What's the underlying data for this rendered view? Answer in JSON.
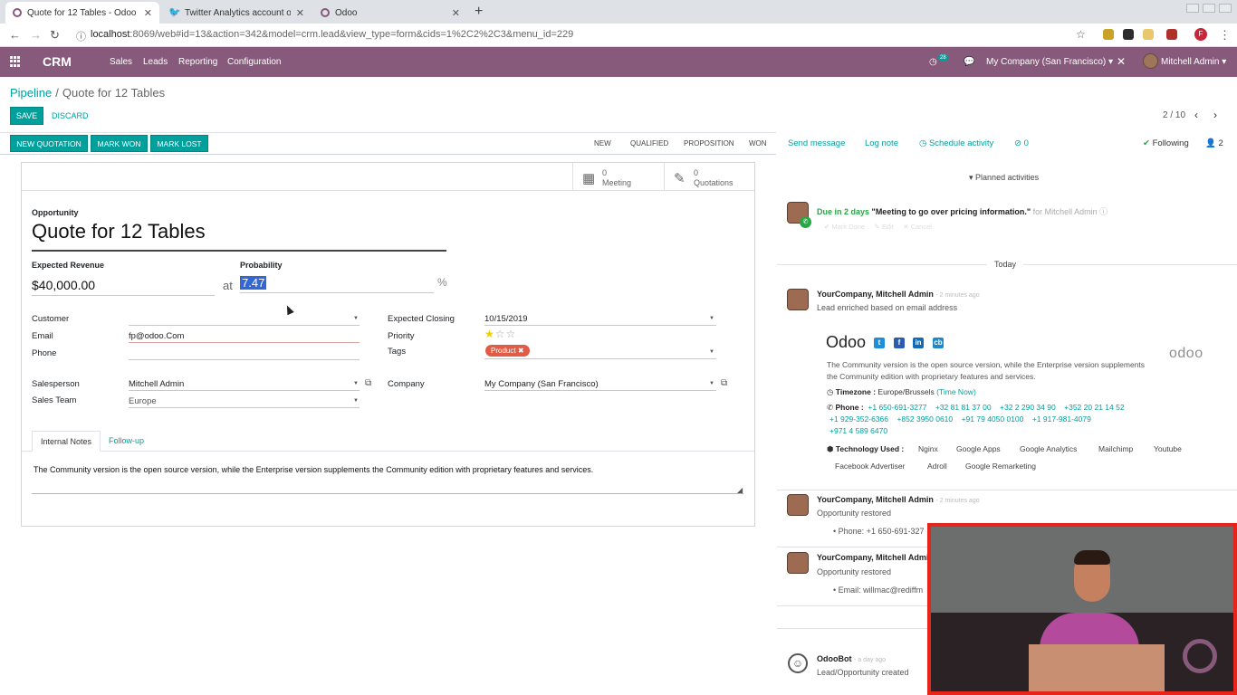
{
  "browser": {
    "tabs": [
      {
        "title": "Quote for 12 Tables - Odoo",
        "active": true
      },
      {
        "title": "Twitter Analytics account ov",
        "active": false
      },
      {
        "title": "Odoo",
        "active": false
      }
    ],
    "url_host": "localhost",
    "url_rest": ":8069/web#id=13&action=342&model=crm.lead&view_type=form&cids=1%2C2%2C3&menu_id=229",
    "profile_initial": "F"
  },
  "navbar": {
    "brand": "CRM",
    "menus": [
      "Sales",
      "Leads",
      "Reporting",
      "Configuration"
    ],
    "activity_count": "28",
    "company": "My Company (San Francisco)",
    "user": "Mitchell Admin"
  },
  "breadcrumb": {
    "parent": "Pipeline",
    "separator": "/",
    "current": "Quote for 12 Tables"
  },
  "actions": {
    "save": "SAVE",
    "discard": "DISCARD"
  },
  "pager": {
    "text": "2 / 10"
  },
  "statusbar": {
    "buttons": [
      "NEW QUOTATION",
      "MARK WON",
      "MARK LOST"
    ],
    "stages": [
      "NEW",
      "QUALIFIED",
      "PROPOSITION",
      "WON"
    ]
  },
  "smart_buttons": [
    {
      "count": "0",
      "label": "Meeting",
      "icon": "calendar-icon"
    },
    {
      "count": "0",
      "label": "Quotations",
      "icon": "pencil-square-icon"
    }
  ],
  "form": {
    "opportunity_label": "Opportunity",
    "title": "Quote for 12 Tables",
    "expected_revenue_label": "Expected Revenue",
    "expected_revenue": "$40,000.00",
    "at": "at",
    "probability_label": "Probability",
    "probability": "7.47",
    "percent": "%",
    "customer_label": "Customer",
    "customer": "",
    "email_label": "Email",
    "email": "fp@odoo.Com",
    "phone_label": "Phone",
    "phone": "",
    "salesperson_label": "Salesperson",
    "salesperson": "Mitchell Admin",
    "sales_team_label": "Sales Team",
    "sales_team": "Europe",
    "expected_closing_label": "Expected Closing",
    "expected_closing": "10/15/2019",
    "priority_label": "Priority",
    "priority_stars": 1,
    "priority_max": 3,
    "tags_label": "Tags",
    "tag": "Product",
    "company_label": "Company",
    "company": "My Company (San Francisco)"
  },
  "notebook": {
    "tabs": [
      "Internal Notes",
      "Follow-up"
    ],
    "note": "The Community version is the open source version, while the Enterprise version supplements the Community edition with proprietary features and services."
  },
  "chatter": {
    "send_message": "Send message",
    "log_note": "Log note",
    "schedule_activity": "Schedule activity",
    "attachments": "0",
    "following": "Following",
    "followers": "2",
    "planned_activities": "Planned activities",
    "activity": {
      "due": "Due in 2 days",
      "summary": "\"Meeting to go over pricing information.\"",
      "for": "for Mitchell Admin",
      "actions": [
        "Mark Done",
        "Edit",
        "Cancel"
      ]
    },
    "today_label": "Today",
    "messages": [
      {
        "author": "YourCompany, Mitchell Admin",
        "date": "- 2 minutes ago",
        "body": "Lead enriched based on email address"
      },
      {
        "author": "YourCompany, Mitchell Admin",
        "date": "- 2 minutes ago",
        "body": "Opportunity restored",
        "detail": "Phone: +1 650-691-327"
      },
      {
        "author": "YourCompany, Mitchell Admin",
        "date": "",
        "body": "Opportunity restored",
        "detail": "Email: willmac@rediffm"
      },
      {
        "author": "OdooBot",
        "date": "- a day ago",
        "body": "Lead/Opportunity created"
      }
    ],
    "card": {
      "name": "Odoo",
      "logo": "odoo",
      "description": "The Community version is the open source version, while the Enterprise version supplements the Community edition with proprietary features and services.",
      "timezone_label": "Timezone :",
      "timezone": "Europe/Brussels",
      "time_now": "(Time Now)",
      "phone_label": "Phone :",
      "phones_line1": [
        "+1 650-691-3277",
        "+32 81 81 37 00",
        "+32 2 290 34 90",
        "+352 20 21 14 52"
      ],
      "phones_line2": [
        "+1 929-352-6366",
        "+852 3950 0610",
        "+91 79 4050 0100",
        "+1 917-981-4079"
      ],
      "phones_line3": [
        "+971 4 589 6470"
      ],
      "tech_label": "Technology Used :",
      "tech_line1": [
        "Nginx",
        "Google Apps",
        "Google Analytics",
        "Mailchimp",
        "Youtube"
      ],
      "tech_line2": [
        "Facebook Advertiser",
        "Adroll",
        "Google Remarketing"
      ]
    }
  },
  "colors": {
    "brand": "#875a7b",
    "accent": "#00a09d",
    "tag": "#e25c45",
    "webcam_border": "#e8231a"
  }
}
